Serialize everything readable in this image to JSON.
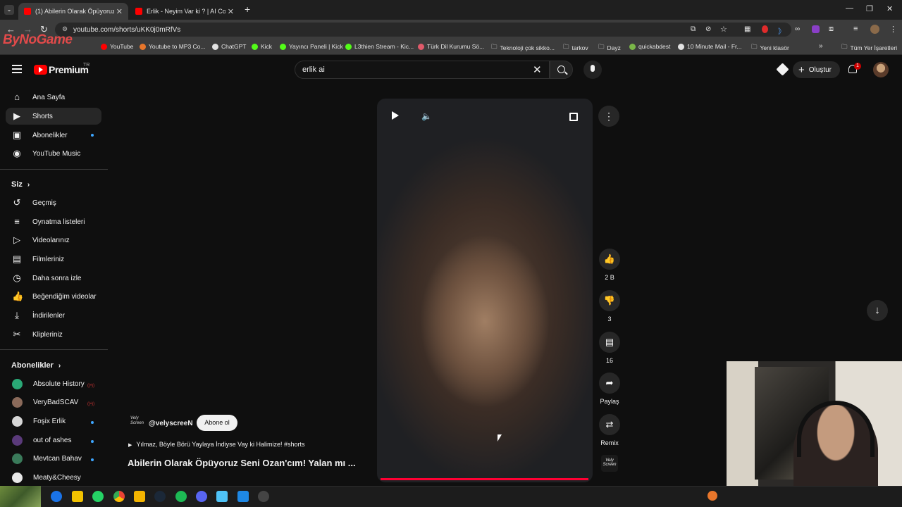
{
  "browser": {
    "tabs": [
      {
        "title": "(1) Abilerin Olarak Öpüyoruz Se",
        "active": true
      },
      {
        "title": "Erlik - Neyim Var ki ? | AI Cover",
        "active": false
      }
    ],
    "url": "youtube.com/shorts/uKK0j0mRfVs",
    "bookmarks": [
      {
        "label": "YouTube",
        "color": "#ff0000"
      },
      {
        "label": "Youtube to MP3 Co...",
        "color": "#e8762b"
      },
      {
        "label": "ChatGPT",
        "color": "#e3e3e3"
      },
      {
        "label": "Kick",
        "color": "#53fc18"
      },
      {
        "label": "Yayıncı Paneli | Kick",
        "color": "#53fc18"
      },
      {
        "label": "L3thien Stream - Kic...",
        "color": "#53fc18"
      },
      {
        "label": "Türk Dil Kurumu Sö...",
        "color": "#e05a6a"
      },
      {
        "label": "Teknoloji çok sikko...",
        "color": "folder"
      },
      {
        "label": "tarkov",
        "color": "folder"
      },
      {
        "label": "Dayz",
        "color": "folder"
      },
      {
        "label": "quickabdest",
        "color": "#7ab648"
      },
      {
        "label": "10 Minute Mail - Fr...",
        "color": "#e3e3e3"
      },
      {
        "label": "Yeni klasör",
        "color": "folder"
      }
    ],
    "all_bookmarks": "Tüm Yer İşaretleri",
    "watermark": "ByNoGame"
  },
  "header": {
    "brand": "Premium",
    "region": "TR",
    "search_value": "erlik ai",
    "create_label": "Oluştur",
    "notification_count": "1"
  },
  "sidebar": {
    "main": [
      {
        "label": "Ana Sayfa",
        "icon": "home-icon",
        "active": false
      },
      {
        "label": "Shorts",
        "icon": "shorts-icon",
        "active": true
      },
      {
        "label": "Abonelikler",
        "icon": "subscriptions-icon",
        "active": false
      },
      {
        "label": "YouTube Music",
        "icon": "music-icon",
        "active": false
      }
    ],
    "you_heading": "Siz",
    "you": [
      {
        "label": "Geçmiş",
        "icon": "history-icon"
      },
      {
        "label": "Oynatma listeleri",
        "icon": "playlist-icon"
      },
      {
        "label": "Videolarınız",
        "icon": "your-videos-icon"
      },
      {
        "label": "Filmleriniz",
        "icon": "movies-icon"
      },
      {
        "label": "Daha sonra izle",
        "icon": "watch-later-icon"
      },
      {
        "label": "Beğendiğim videolar",
        "icon": "liked-icon"
      },
      {
        "label": "İndirilenler",
        "icon": "download-icon"
      },
      {
        "label": "Klipleriniz",
        "icon": "clips-icon"
      }
    ],
    "subs_heading": "Abonelikler",
    "subs": [
      {
        "label": "Absolute History",
        "color": "#2aa876"
      },
      {
        "label": "VeryBadSCAV",
        "color": "#8a6a5a"
      },
      {
        "label": "Foşix Erlik",
        "color": "#d6d6d6"
      },
      {
        "label": "out of ashes",
        "color": "#5a3a7a"
      },
      {
        "label": "Mevtcan Bahav",
        "color": "#3a7a5a"
      },
      {
        "label": "Meaty&Cheesy",
        "color": "#e8e8e8"
      }
    ]
  },
  "short": {
    "channel_handle": "@velyscreeN",
    "channel_logo": "Vely Screen",
    "subscribe_label": "Abone ol",
    "description": "Yılmaz, Böyle Börü Yaylaya İndiyse Vay ki Halimize! #shorts",
    "title": "Abilerin Olarak Öpüyoruz Seni Ozan'cım! Yalan mı ...",
    "likes": "2 B",
    "dislikes": "3",
    "comments": "16",
    "share_label": "Paylaş",
    "remix_label": "Remix"
  }
}
